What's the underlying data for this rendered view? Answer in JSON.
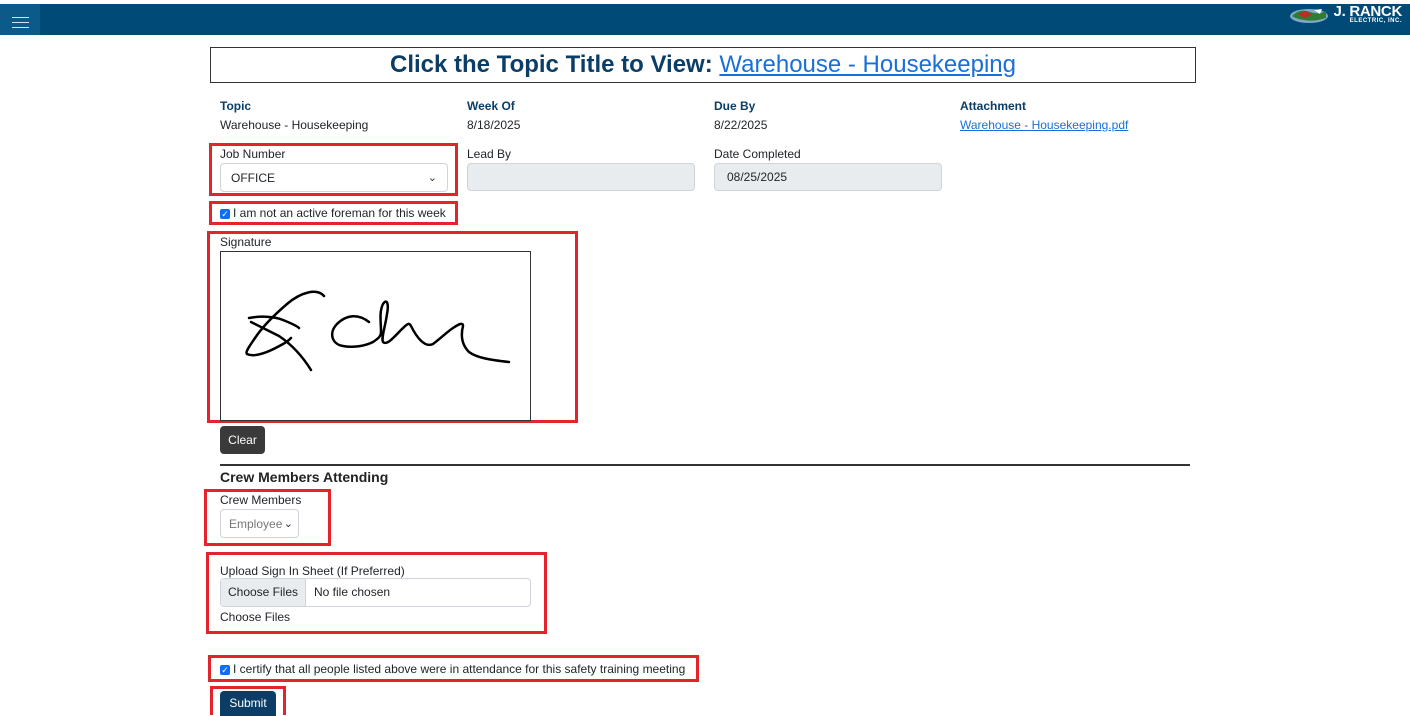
{
  "app": {
    "logo_text": "J. RANCK",
    "logo_subtext": "ELECTRIC, INC."
  },
  "header": {
    "prefix": "Click the Topic Title to View:",
    "topic_link": "Warehouse - Housekeeping"
  },
  "info": {
    "topic_label": "Topic",
    "topic_value": "Warehouse - Housekeeping",
    "week_label": "Week Of",
    "week_value": "8/18/2025",
    "due_label": "Due By",
    "due_value": "8/22/2025",
    "attachment_label": "Attachment",
    "attachment_value": "Warehouse - Housekeeping.pdf"
  },
  "form": {
    "job_label": "Job Number",
    "job_value": "OFFICE",
    "lead_label": "Lead By",
    "lead_value": "",
    "date_label": "Date Completed",
    "date_value": "08/25/2025",
    "foreman_checkbox": "I am not an active foreman for this week",
    "signature_label": "Signature",
    "clear_label": "Clear",
    "crew_section": "Crew Members Attending",
    "crew_label": "Crew Members",
    "crew_value": "Employee",
    "upload_label": "Upload Sign In Sheet (If Preferred)",
    "choose_files": "Choose Files",
    "no_file": "No file chosen",
    "choose_files_note": "Choose Files",
    "certify_checkbox": "I certify that all people listed above were in attendance for this safety training meeting",
    "submit_label": "Submit"
  },
  "colors": {
    "topbar": "#004a78",
    "accent": "#0b3d66",
    "highlight": "#e3242b",
    "link": "#1a6fd8"
  }
}
